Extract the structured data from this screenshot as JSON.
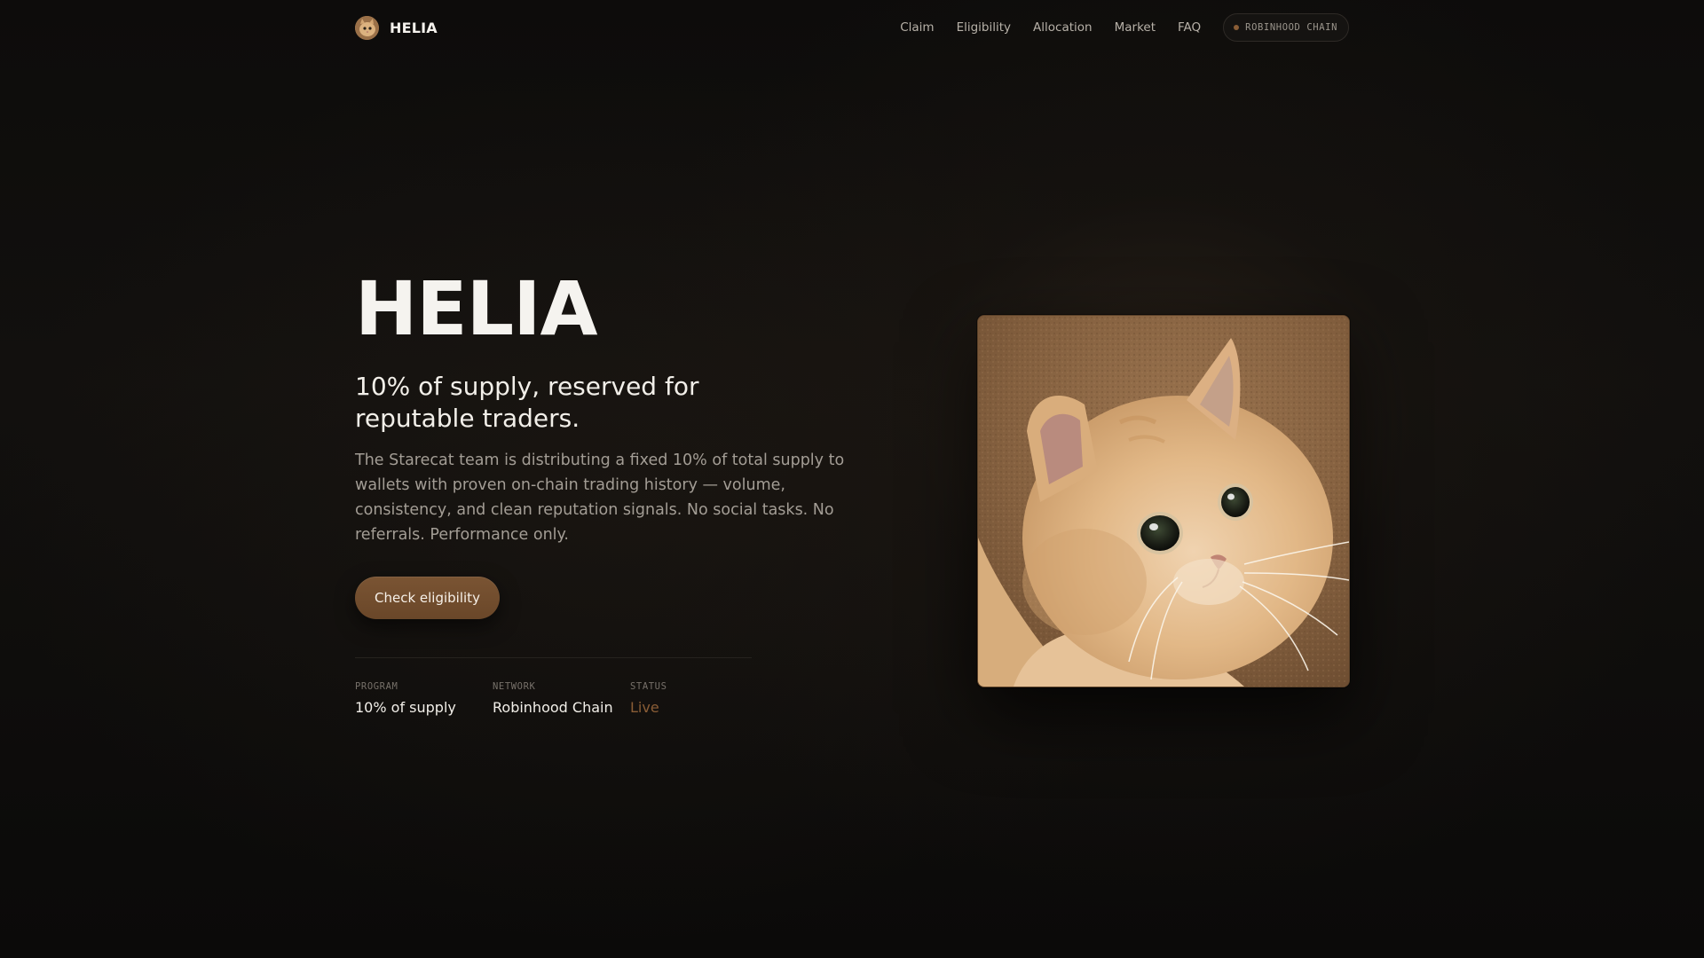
{
  "header": {
    "brand": "HELIA",
    "brand_icon": "cat-avatar-icon",
    "nav": [
      {
        "label": "Claim"
      },
      {
        "label": "Eligibility"
      },
      {
        "label": "Allocation"
      },
      {
        "label": "Market"
      },
      {
        "label": "FAQ"
      }
    ],
    "chain_badge": "ROBINHOOD CHAIN"
  },
  "hero": {
    "title": "HELIA",
    "subtitle": "10% of supply, reserved for reputable traders.",
    "description": "The Starecat team is distributing a fixed 10% of total supply to wallets with proven on-chain trading history — volume, consistency, and clean reputation signals. No social tasks. No referrals. Performance only.",
    "cta_label": "Check eligibility",
    "stats": [
      {
        "label": "PROGRAM",
        "value": "10% of supply"
      },
      {
        "label": "NETWORK",
        "value": "Robinhood Chain"
      },
      {
        "label": "STATUS",
        "value": "Live"
      }
    ],
    "image": "starecat-photo"
  },
  "colors": {
    "background": "#0c0b0a",
    "accent": "#7a5433",
    "status_live": "#8a5d36",
    "text_primary": "#f2efe9",
    "text_muted": "#a39d95"
  }
}
